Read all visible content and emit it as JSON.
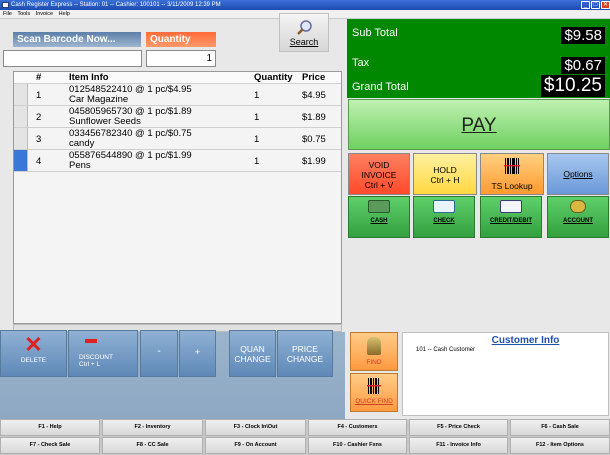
{
  "window": {
    "title": "Cash Register Express -- Station: 01 -- Cashier: 100101 -- 3/11/2009 12:39 PM"
  },
  "menu": [
    "File",
    "Tools",
    "Invoice",
    "Help"
  ],
  "scan": {
    "label": "Scan Barcode Now...",
    "value": ""
  },
  "quantity": {
    "label": "Quantity",
    "value": "1"
  },
  "search_label": "Search",
  "grid": {
    "columns": [
      "#",
      "Item Info",
      "Quantity",
      "Price"
    ],
    "rows": [
      {
        "num": "1",
        "line1": "012548522410 @ 1 pc/$4.95",
        "line2": "Car Magazine",
        "qty": "1",
        "price": "$4.95"
      },
      {
        "num": "2",
        "line1": "045805965730 @ 1 pc/$1.89",
        "line2": "Sunflower Seeds",
        "qty": "1",
        "price": "$1.89"
      },
      {
        "num": "3",
        "line1": "033456782340 @ 1 pc/$0.75",
        "line2": "candy",
        "qty": "1",
        "price": "$0.75"
      },
      {
        "num": "4",
        "line1": "055876544890 @ 1 pc/$1.99",
        "line2": "Pens",
        "qty": "1",
        "price": "$1.99"
      }
    ]
  },
  "totals": {
    "subtotal_label": "Sub Total",
    "subtotal": "$9.58",
    "tax_label": "Tax",
    "tax": "$0.67",
    "grand_label": "Grand Total",
    "grand": "$10.25"
  },
  "pay_label": "PAY",
  "func_buttons": {
    "void_l1": "VOID",
    "void_l2": "INVOICE",
    "void_l3": "Ctrl + V",
    "hold_l1": "HOLD",
    "hold_l2": "Ctrl + H",
    "ts_lookup": "TS Lookup",
    "options": "Options"
  },
  "tenders": [
    "CASH",
    "CHECK",
    "CREDIT/DEBIT",
    "ACCOUNT"
  ],
  "actions": {
    "delete": "DELETE",
    "discount_l1": "DISCOUNT",
    "discount_l2": "Ctrl + L",
    "minus": "-",
    "plus": "+",
    "quan_l1": "QUAN",
    "quan_l2": "CHANGE",
    "price_l1": "PRICE",
    "price_l2": "CHANGE"
  },
  "find_label": "FIND",
  "quickfind_label": "QUICK FIND",
  "customer": {
    "title": "Customer Info",
    "line": "101 -- Cash Customer"
  },
  "fkeys_row1": [
    "F1 - Help",
    "F2 - Inventory",
    "F3 - Clock In\\Out",
    "F4 - Customers",
    "F5 - Price Check",
    "F6 - Cash Sale"
  ],
  "fkeys_row2": [
    "F7 - Check Sale",
    "F8 - CC Sale",
    "F9 - On Account",
    "F10 - Cashier Fxns",
    "F11 - Invoice Info",
    "F12 - Item Options"
  ],
  "colors": {
    "green_panel": "#008800",
    "pay": "#6fd060",
    "void": "#ff5a3a",
    "hold": "#ffe066",
    "scan_header": "#5c7fa8",
    "qty_header": "#ff6b3a",
    "action_blue": "#5f89b8"
  },
  "icons": {
    "search": "magnifier-icon",
    "ts_lookup": "barcode-icon",
    "find": "person-icon",
    "quick_find": "barcode-icon",
    "delete": "x-icon"
  }
}
